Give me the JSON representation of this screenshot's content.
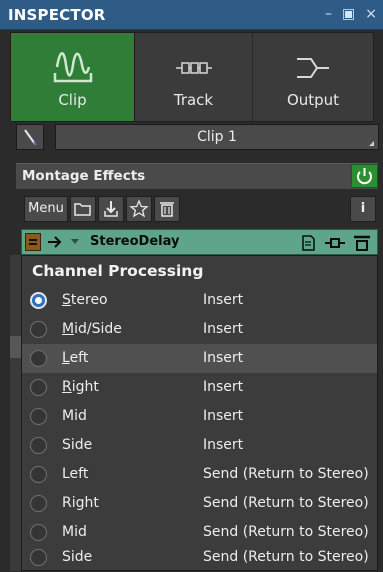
{
  "inspector": {
    "title": "INSPECTOR",
    "controls": {
      "minimize": "–",
      "layout": "▣",
      "close": "×"
    }
  },
  "tabs": [
    {
      "label": "Clip",
      "icon": "waveform-icon",
      "active": true
    },
    {
      "label": "Track",
      "icon": "track-icon",
      "active": false
    },
    {
      "label": "Output",
      "icon": "output-icon",
      "active": false
    }
  ],
  "clip_selector": {
    "value": "Clip 1"
  },
  "montage_effects": {
    "title": "Montage Effects",
    "toolbar": {
      "menu_label": "Menu"
    },
    "info_label": "i",
    "effect": {
      "name": "StereoDelay"
    }
  },
  "channel_menu": {
    "title": "Channel Processing",
    "rows": [
      {
        "label": "Stereo",
        "mode": "Insert",
        "checked": true,
        "highlight": false
      },
      {
        "label": "Mid/Side",
        "mode": "Insert",
        "checked": false,
        "highlight": false
      },
      {
        "label": "Left",
        "mode": "Insert",
        "checked": false,
        "highlight": true
      },
      {
        "label": "Right",
        "mode": "Insert",
        "checked": false,
        "highlight": false
      },
      {
        "label": "Mid",
        "mode": "Insert",
        "checked": false,
        "highlight": false
      },
      {
        "label": "Side",
        "mode": "Insert",
        "checked": false,
        "highlight": false
      },
      {
        "label": "Left",
        "mode": "Send (Return to Stereo)",
        "checked": false,
        "highlight": false
      },
      {
        "label": "Right",
        "mode": "Send (Return to Stereo)",
        "checked": false,
        "highlight": false
      },
      {
        "label": "Mid",
        "mode": "Send (Return to Stereo)",
        "checked": false,
        "highlight": false
      },
      {
        "label": "Side",
        "mode": "Send (Return to Stereo)",
        "checked": false,
        "highlight": false
      }
    ]
  },
  "colors": {
    "header_blue": "#2f5b87",
    "active_tab_green": "#2f7d36",
    "effect_row_green": "#5fa58a",
    "power_green": "#2b8f32",
    "radio_selected": "#2e6fc0"
  }
}
